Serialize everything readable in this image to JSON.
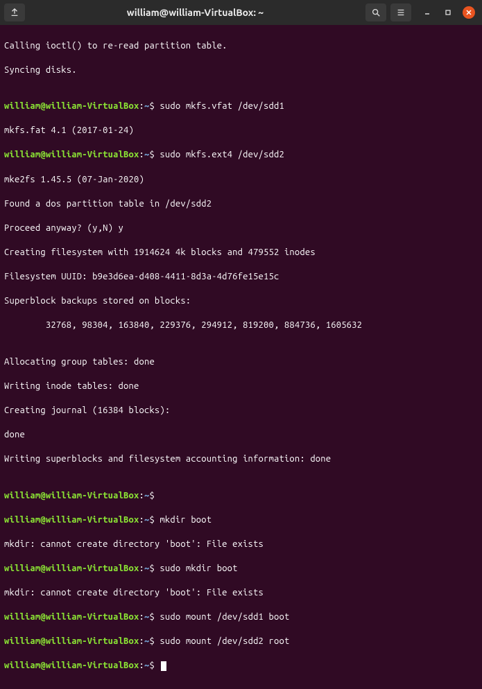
{
  "titlebar": {
    "title": "william@william-VirtualBox: ~"
  },
  "prompt": {
    "user": "william",
    "at": "@",
    "host": "william-VirtualBox",
    "colon": ":",
    "path": "~",
    "dollar": "$"
  },
  "lines": {
    "l0": "Calling ioctl() to re-read partition table.",
    "l1": "Syncing disks.",
    "l2": "",
    "cmd1": " sudo mkfs.vfat /dev/sdd1",
    "l3": "mkfs.fat 4.1 (2017-01-24)",
    "cmd2": " sudo mkfs.ext4 /dev/sdd2",
    "l4": "mke2fs 1.45.5 (07-Jan-2020)",
    "l5": "Found a dos partition table in /dev/sdd2",
    "l6": "Proceed anyway? (y,N) y",
    "l7": "Creating filesystem with 1914624 4k blocks and 479552 inodes",
    "l8": "Filesystem UUID: b9e3d6ea-d408-4411-8d3a-4d76fe15e15c",
    "l9": "Superblock backups stored on blocks:",
    "l10": "        32768, 98304, 163840, 229376, 294912, 819200, 884736, 1605632",
    "l11": "",
    "l12": "Allocating group tables: done",
    "l13": "Writing inode tables: done",
    "l14": "Creating journal (16384 blocks):",
    "l15": "done",
    "l16": "Writing superblocks and filesystem accounting information: done",
    "l17": "",
    "cmd3": "",
    "cmd4": " mkdir boot",
    "l18": "mkdir: cannot create directory 'boot': File exists",
    "cmd5": " sudo mkdir boot",
    "l19": "mkdir: cannot create directory 'boot': File exists",
    "cmd6": " sudo mount /dev/sdd1 boot",
    "cmd7": " sudo mount /dev/sdd2 root",
    "cmd8": " "
  }
}
